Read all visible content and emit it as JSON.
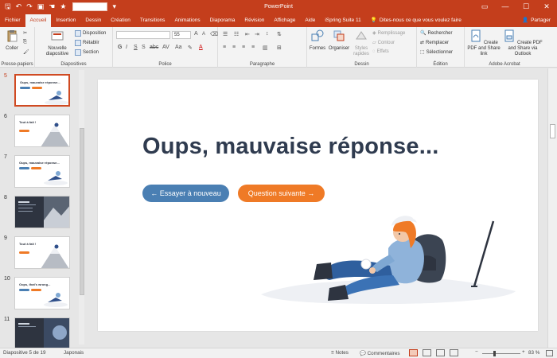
{
  "window": {
    "title": "PowerPoint"
  },
  "tabs": [
    "Fichier",
    "Accueil",
    "Insertion",
    "Dessin",
    "Création",
    "Transitions",
    "Animations",
    "Diaporama",
    "Révision",
    "Affichage",
    "Aide",
    "iSpring Suite 11"
  ],
  "tell_me": "Dites-nous ce que vous voulez faire",
  "share": "Partager",
  "ribbon": {
    "presse_papiers": {
      "label": "Presse-papiers",
      "coller": "Coller"
    },
    "diapositives": {
      "label": "Diapositives",
      "nouvelle": "Nouvelle diapositive",
      "disposition": "Disposition",
      "retablir": "Rétablir",
      "section": "Section"
    },
    "police": {
      "label": "Police",
      "size": "55"
    },
    "paragraphe": {
      "label": "Paragraphe"
    },
    "dessin": {
      "label": "Dessin",
      "formes": "Formes",
      "organiser": "Organiser",
      "styles": "Styles rapides",
      "remplissage": "Remplissage",
      "contour": "Contour",
      "effets": "Effets"
    },
    "edition": {
      "label": "Édition",
      "rechercher": "Rechercher",
      "remplacer": "Remplacer",
      "selectionner": "Sélectionner"
    },
    "acrobat": {
      "label": "Adobe Acrobat",
      "create1": "Create PDF and Share link",
      "create2": "Create PDF and Share via Outlook"
    }
  },
  "thumbnails": [
    {
      "num": "5",
      "title": "Oups, mauvaise réponse...",
      "style": "light",
      "selected": true
    },
    {
      "num": "6",
      "title": "Tout à fait !",
      "style": "light",
      "selected": false
    },
    {
      "num": "7",
      "title": "Oups, mauvaise réponse...",
      "style": "light",
      "selected": false
    },
    {
      "num": "8",
      "title": "",
      "style": "dark",
      "selected": false
    },
    {
      "num": "9",
      "title": "Tout à fait !",
      "style": "light",
      "selected": false
    },
    {
      "num": "10",
      "title": "Oops, that's wrong...",
      "style": "light",
      "selected": false
    },
    {
      "num": "11",
      "title": "",
      "style": "dark",
      "selected": false
    }
  ],
  "slide": {
    "heading": "Oups, mauvaise réponse...",
    "btn_retry": "← Essayer à nouveau",
    "btn_next": "Question suivante →"
  },
  "status": {
    "slide_info": "Diapositive 5 de 19",
    "language": "Japonais",
    "notes": "Notes",
    "comments": "Commentaires",
    "zoom": "83 %"
  },
  "colors": {
    "accent": "#c43e1c",
    "btn_blue": "#4a7fb3",
    "btn_orange": "#ef7a26",
    "heading": "#2f3b4f"
  }
}
